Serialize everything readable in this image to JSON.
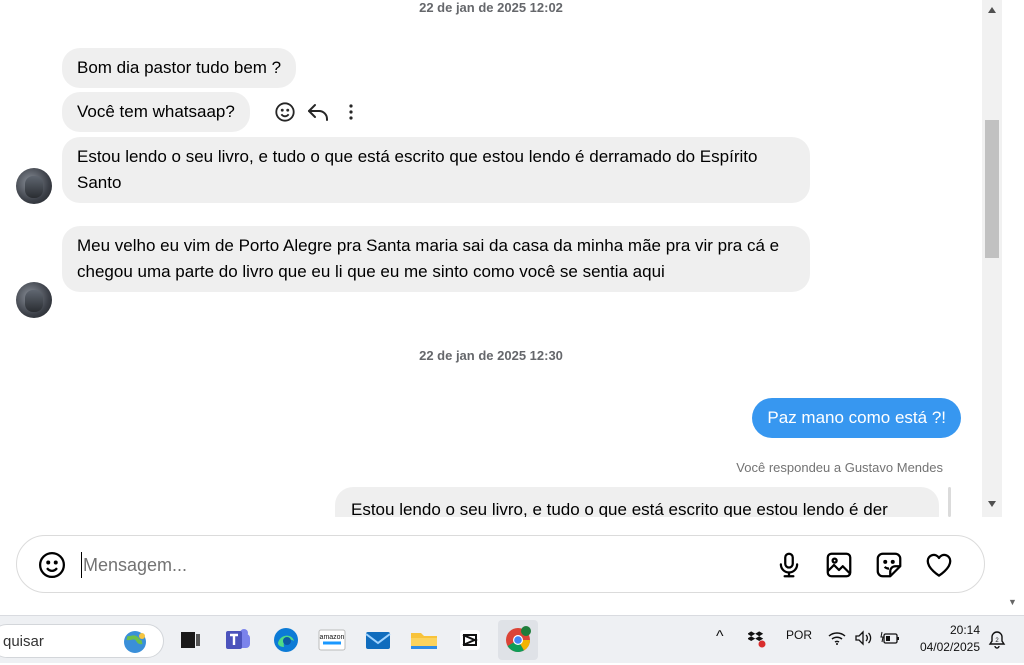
{
  "timestamps": [
    "22 de jan de 2025 12:02",
    "22 de jan de 2025 12:30"
  ],
  "incoming": [
    {
      "text": "Bom dia pastor tudo bem ?"
    },
    {
      "text": "Você tem whatsaap?"
    },
    {
      "text": "Estou lendo o seu livro, e tudo o que está escrito que estou lendo é derramado do Espírito Santo"
    },
    {
      "text": "Meu velho eu vim de Porto Alegre pra Santa maria sai da casa da minha mãe pra vir pra cá e chegou uma parte do livro que eu li que eu me sinto como você se sentia aqui"
    }
  ],
  "outgoing": {
    "text": "Paz mano como está ?!"
  },
  "reply": {
    "note": "Você respondeu a Gustavo Mendes",
    "quote": "Estou lendo o seu livro, e tudo o que está escrito que estou lendo é der"
  },
  "composer": {
    "placeholder": "Mensagem..."
  },
  "taskbar": {
    "search_text": "quisar",
    "language": "POR",
    "time": "20:14",
    "date": "04/02/2025",
    "apps": [
      "browser-icon",
      "task-view-icon",
      "teams-icon",
      "edge-icon",
      "amazon-icon",
      "mail-icon",
      "file-explorer-icon",
      "capcut-icon",
      "chrome-icon"
    ]
  },
  "colors": {
    "accent": "#3797f0",
    "bubble": "#efefef",
    "taskbar": "#eef0f3"
  }
}
